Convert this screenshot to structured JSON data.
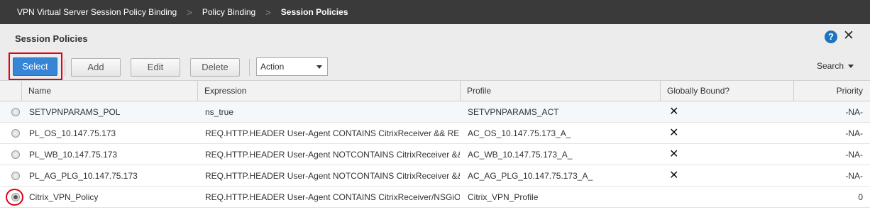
{
  "breadcrumb": {
    "items": [
      "VPN Virtual Server Session Policy Binding",
      "Policy Binding",
      "Session Policies"
    ],
    "separator": ">"
  },
  "panel": {
    "title": "Session Policies",
    "help_label": "?",
    "close_label": "✕"
  },
  "toolbar": {
    "select_label": "Select",
    "add_label": "Add",
    "edit_label": "Edit",
    "delete_label": "Delete",
    "action_label": "Action",
    "search_label": "Search"
  },
  "table": {
    "columns": [
      "Name",
      "Expression",
      "Profile",
      "Globally Bound?",
      "Priority"
    ],
    "rows": [
      {
        "name": "SETVPNPARAMS_POL",
        "expression": "ns_true",
        "profile": "SETVPNPARAMS_ACT",
        "globally_bound": "✕",
        "priority": "-NA-",
        "selected": false
      },
      {
        "name": "PL_OS_10.147.75.173",
        "expression": "REQ.HTTP.HEADER User-Agent CONTAINS CitrixReceiver && RE...",
        "profile": "AC_OS_10.147.75.173_A_",
        "globally_bound": "✕",
        "priority": "-NA-",
        "selected": false
      },
      {
        "name": "PL_WB_10.147.75.173",
        "expression": "REQ.HTTP.HEADER User-Agent NOTCONTAINS CitrixReceiver &&...",
        "profile": "AC_WB_10.147.75.173_A_",
        "globally_bound": "✕",
        "priority": "-NA-",
        "selected": false
      },
      {
        "name": "PL_AG_PLG_10.147.75.173",
        "expression": "REQ.HTTP.HEADER User-Agent NOTCONTAINS CitrixReceiver &&...",
        "profile": "AC_AG_PLG_10.147.75.173_A_",
        "globally_bound": "✕",
        "priority": "-NA-",
        "selected": false
      },
      {
        "name": "Citrix_VPN_Policy",
        "expression": "REQ.HTTP.HEADER User-Agent CONTAINS CitrixReceiver/NSGiOS...",
        "profile": "Citrix_VPN_Profile",
        "globally_bound": "",
        "priority": "0",
        "selected": true
      }
    ]
  },
  "colors": {
    "breadcrumb_bg": "#3a3a3a",
    "primary_button": "#3685d6",
    "highlight": "#e0001b",
    "help_icon": "#1e73be"
  }
}
